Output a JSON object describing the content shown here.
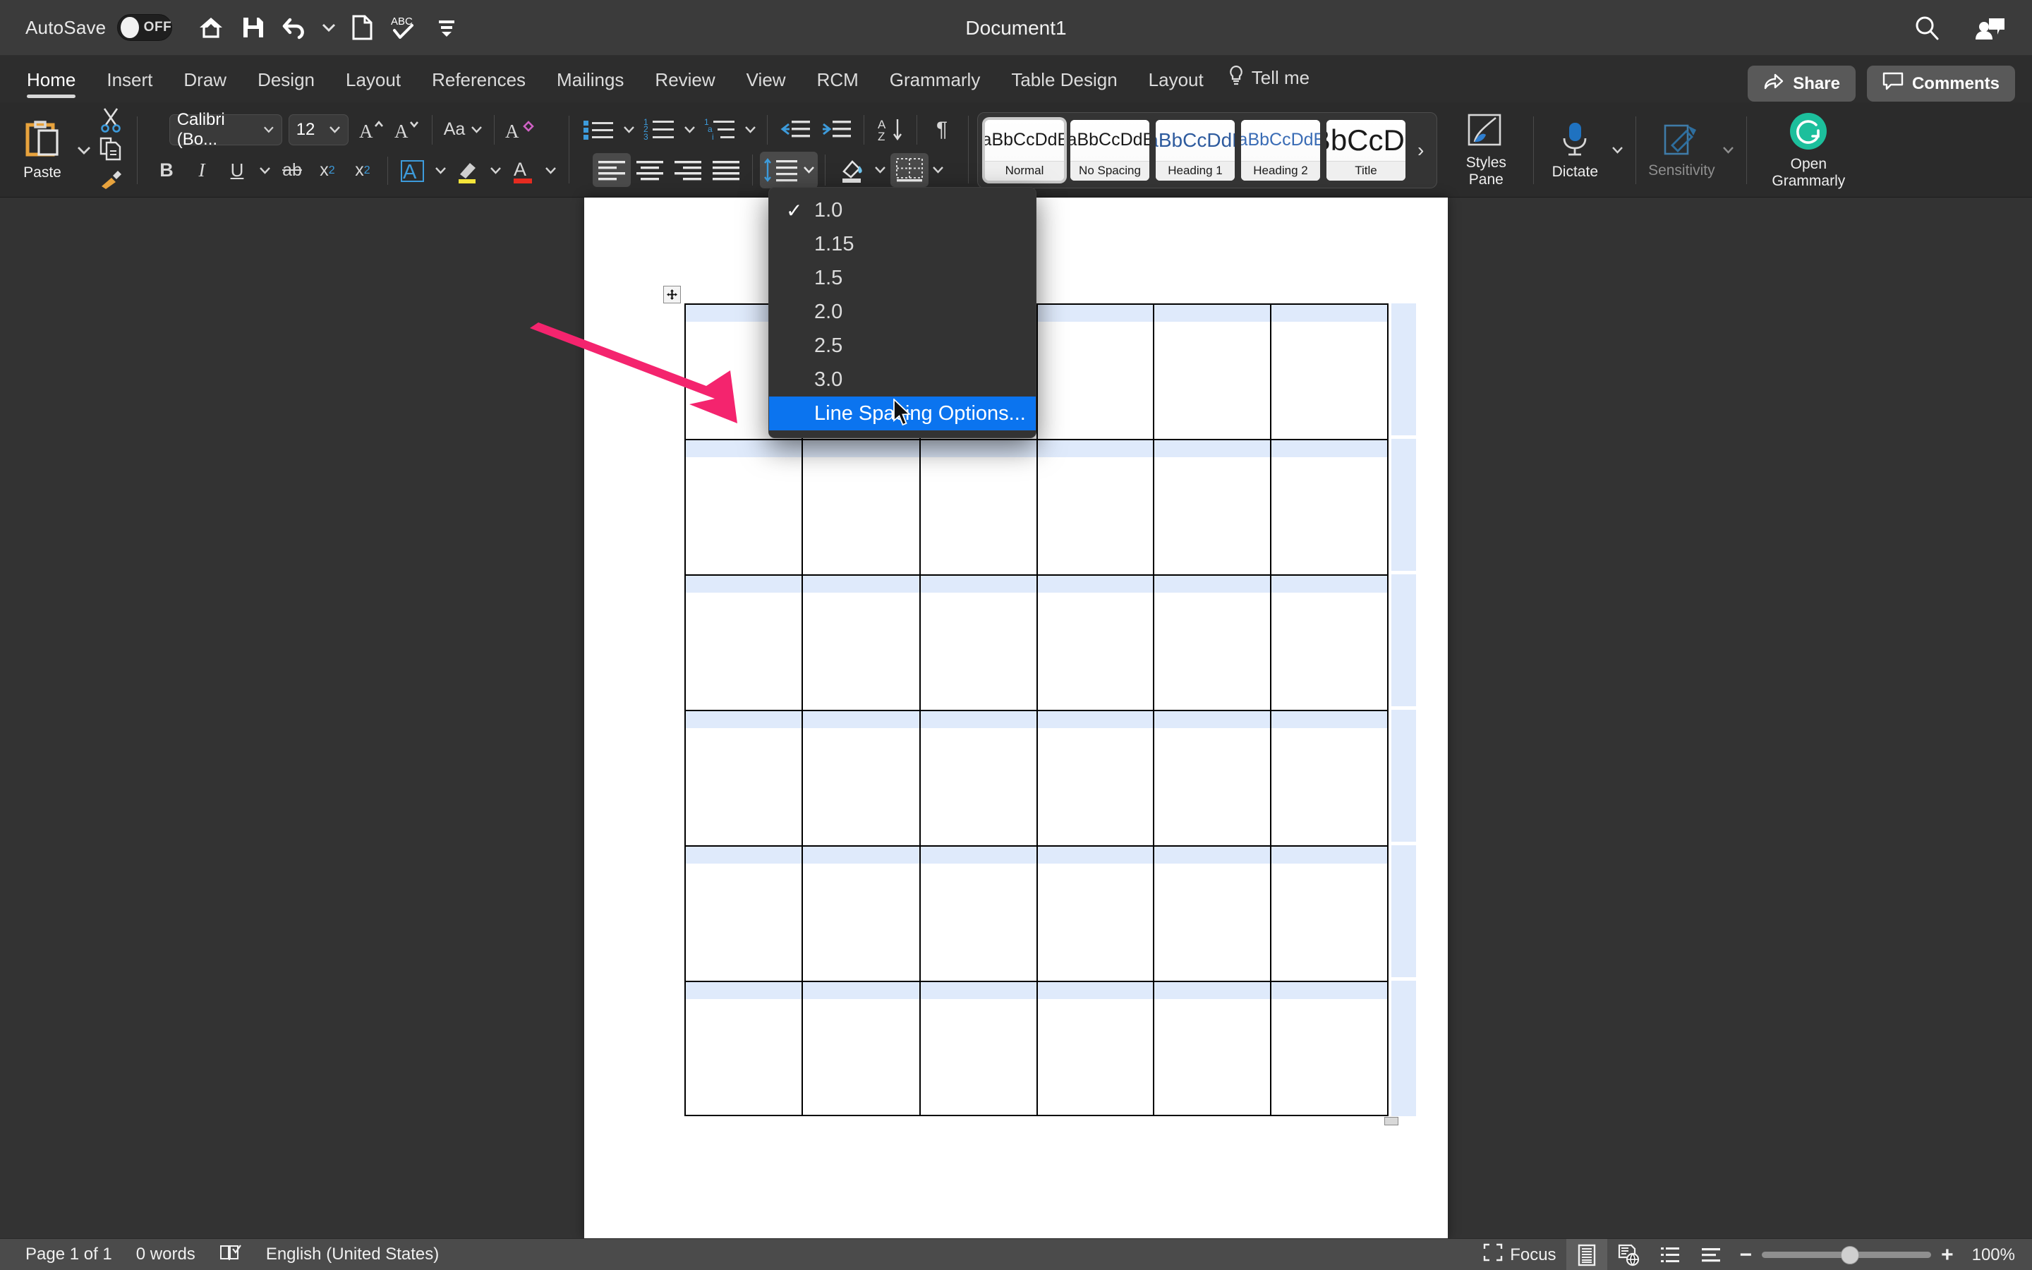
{
  "titlebar": {
    "autosave_label": "AutoSave",
    "autosave_state": "OFF",
    "document_title": "Document1",
    "quick_access": [
      "home-icon",
      "save-icon",
      "undo-icon",
      "undo-dropdown-icon",
      "new-document-icon",
      "spelling-check-icon",
      "customize-toolbar-icon"
    ],
    "right_icons": [
      "search-icon",
      "account-comment-icon"
    ]
  },
  "ribbon_tabs": {
    "items": [
      {
        "label": "Home",
        "active": true
      },
      {
        "label": "Insert",
        "active": false
      },
      {
        "label": "Draw",
        "active": false
      },
      {
        "label": "Design",
        "active": false
      },
      {
        "label": "Layout",
        "active": false
      },
      {
        "label": "References",
        "active": false
      },
      {
        "label": "Mailings",
        "active": false
      },
      {
        "label": "Review",
        "active": false
      },
      {
        "label": "View",
        "active": false
      },
      {
        "label": "RCM",
        "active": false
      },
      {
        "label": "Grammarly",
        "active": false
      },
      {
        "label": "Table Design",
        "active": false
      },
      {
        "label": "Layout",
        "active": false
      }
    ],
    "tell_me": "Tell me",
    "share_label": "Share",
    "comments_label": "Comments"
  },
  "ribbon": {
    "clipboard": {
      "paste_label": "Paste",
      "cut_icon": "scissors-icon",
      "copy_icon": "copy-icon",
      "format_painter_icon": "format-painter-icon"
    },
    "font": {
      "font_name": "Calibri (Bo...",
      "font_size": "12",
      "grow_font_icon": "grow-font-icon",
      "shrink_font_icon": "shrink-font-icon",
      "change_case_label": "Aa",
      "clear_formatting_icon": "clear-formatting-icon",
      "bold_label": "B",
      "italic_label": "I",
      "underline_label": "U",
      "strikethrough_label": "ab",
      "subscript_label": "x",
      "superscript_label": "x",
      "text_effects_label": "A",
      "highlight_icon": "text-highlight-icon",
      "font_color_label": "A"
    },
    "paragraph": {
      "bullets_icon": "bullet-list-icon",
      "numbering_icon": "numbered-list-icon",
      "multilevel_icon": "multilevel-list-icon",
      "decrease_indent_icon": "decrease-indent-icon",
      "increase_indent_icon": "increase-indent-icon",
      "sort_icon": "sort-az-icon",
      "show_marks_label": "¶",
      "align_left_icon": "align-left-icon",
      "align_center_icon": "align-center-icon",
      "align_right_icon": "align-right-icon",
      "justify_icon": "justify-icon",
      "line_spacing_icon": "line-spacing-icon",
      "shading_icon": "shading-icon",
      "borders_icon": "borders-icon"
    },
    "styles": {
      "tiles": [
        {
          "preview": "AaBbCcDdEe",
          "name": "Normal",
          "active": true,
          "color": "#1a1a1a",
          "size": "25px"
        },
        {
          "preview": "AaBbCcDdEe",
          "name": "No Spacing",
          "active": false,
          "color": "#1a1a1a",
          "size": "25px"
        },
        {
          "preview": "AaBbCcDdEe",
          "name": "Heading 1",
          "active": false,
          "color": "#2e5b9e",
          "size": "27px"
        },
        {
          "preview": "AaBbCcDdEe",
          "name": "Heading 2",
          "active": false,
          "color": "#3a6cb5",
          "size": "25px"
        },
        {
          "preview": "AaBbCcDdEe",
          "name": "Title",
          "active": false,
          "color": "#1a1a1a",
          "size": "40px"
        }
      ],
      "next_arrow": "›",
      "styles_pane_label": "Styles\nPane",
      "styles_pane_line1": "Styles",
      "styles_pane_line2": "Pane"
    },
    "dictate_label": "Dictate",
    "sensitivity_label": "Sensitivity",
    "grammarly_line1": "Open",
    "grammarly_line2": "Grammarly",
    "grammarly_color": "#1cbf9c"
  },
  "line_spacing_menu": {
    "items": [
      {
        "label": "1.0",
        "checked": true,
        "highlighted": false
      },
      {
        "label": "1.15",
        "checked": false,
        "highlighted": false
      },
      {
        "label": "1.5",
        "checked": false,
        "highlighted": false
      },
      {
        "label": "2.0",
        "checked": false,
        "highlighted": false
      },
      {
        "label": "2.5",
        "checked": false,
        "highlighted": false
      },
      {
        "label": "3.0",
        "checked": false,
        "highlighted": false
      },
      {
        "label": "Line Spacing Options...",
        "checked": false,
        "highlighted": true
      }
    ],
    "highlight_color": "#0b74ef"
  },
  "annotation": {
    "arrow_color": "#f4246e",
    "points_to": "Line Spacing Options..."
  },
  "document": {
    "table": {
      "rows": 6,
      "columns": 6,
      "cells": [
        [
          "",
          "",
          "",
          "",
          "",
          ""
        ],
        [
          "",
          "",
          "",
          "",
          "",
          ""
        ],
        [
          "",
          "",
          "",
          "",
          "",
          ""
        ],
        [
          "",
          "",
          "",
          "",
          "",
          ""
        ],
        [
          "",
          "",
          "",
          "",
          "",
          ""
        ],
        [
          "",
          "",
          "",
          "",
          "",
          ""
        ]
      ],
      "row_band_color": "#dfeafb",
      "border_color": "#000000"
    },
    "move_handle_icon": "table-move-handle-icon",
    "resize_handle_icon": "table-resize-handle-icon"
  },
  "statusbar": {
    "page_label": "Page 1 of 1",
    "word_count": "0 words",
    "proofing_icon": "proofing-icon",
    "language": "English (United States)",
    "focus_label": "Focus",
    "views": [
      "print-layout-icon",
      "web-layout-icon",
      "outline-icon",
      "draft-icon"
    ],
    "zoom_out_label": "−",
    "zoom_in_label": "+",
    "zoom_level": "100%"
  }
}
